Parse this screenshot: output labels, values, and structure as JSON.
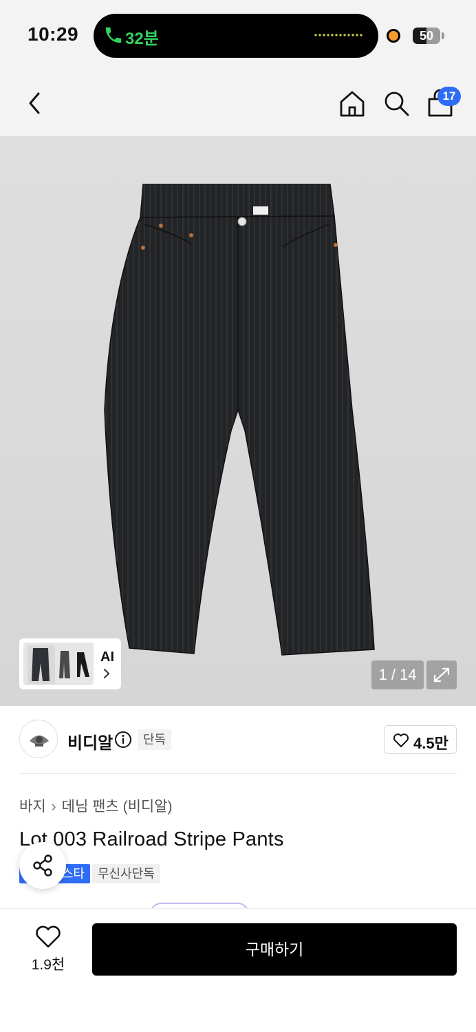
{
  "status_bar": {
    "time": "10:29",
    "call_duration": "32분",
    "battery_level": "50",
    "battery_fraction": 0.5
  },
  "nav": {
    "back_icon": "chevron-left-icon",
    "home_icon": "home-icon",
    "search_icon": "search-icon",
    "bag_icon": "shopping-bag-icon",
    "cart_count": "17"
  },
  "gallery": {
    "ai_label": "AI",
    "counter": "1 / 14",
    "expand_icon": "expand-icon"
  },
  "brand": {
    "name": "비디알",
    "exclusive_tag": "단독",
    "like_count": "4.5만"
  },
  "product": {
    "breadcrumb": [
      "바지",
      "데님 팬츠 (비디알)"
    ],
    "title": "Lot 003 Railroad Stripe Pants",
    "tags": [
      "스타",
      "무신사단독"
    ]
  },
  "bottom_bar": {
    "favorite_count": "1.9천",
    "buy_label": "구매하기"
  },
  "colors": {
    "accent_blue": "#2f6df6",
    "call_green": "#33d35d",
    "buy_button": "#000000"
  }
}
